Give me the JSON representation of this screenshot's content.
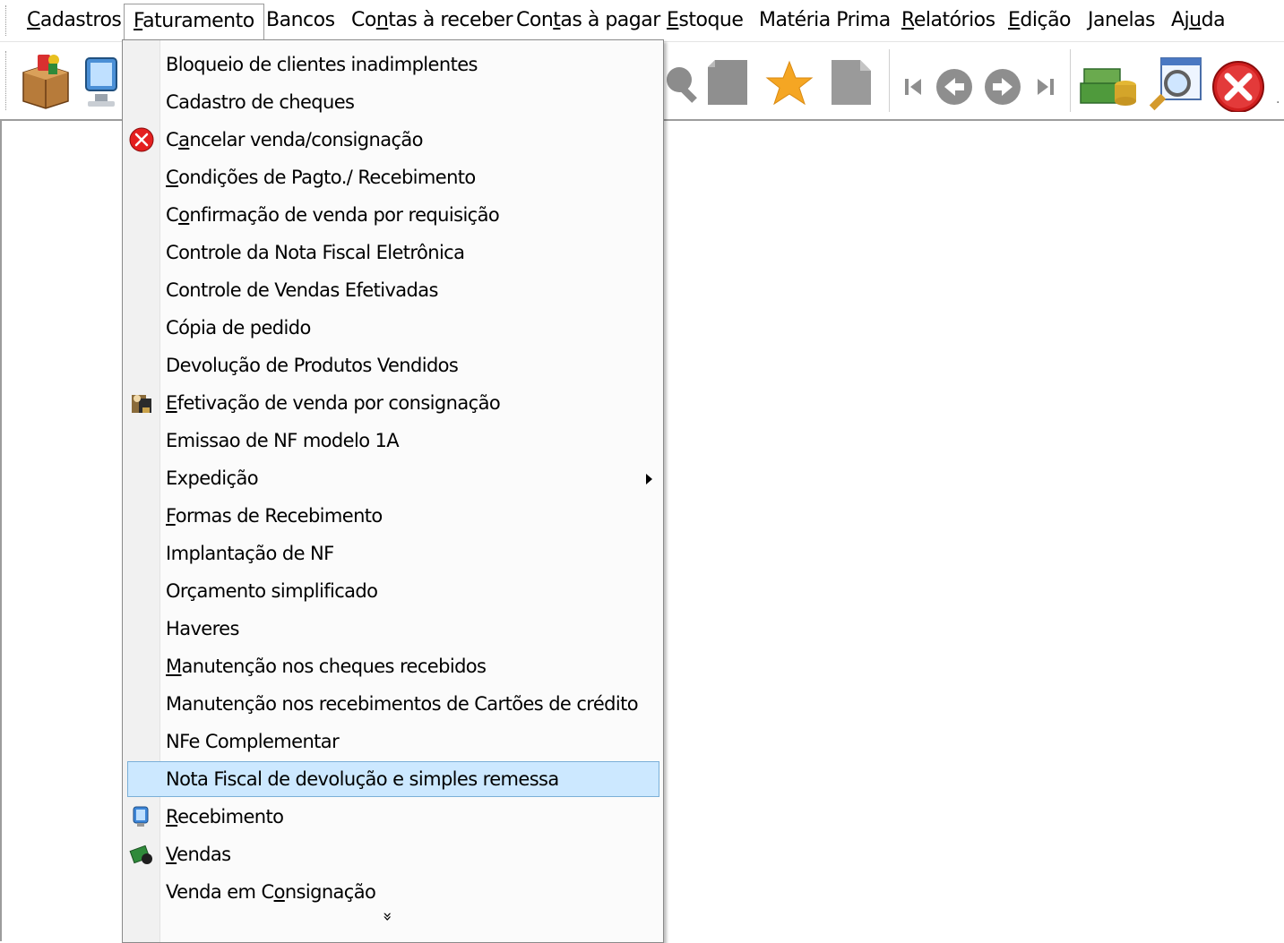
{
  "menubar": {
    "items": [
      {
        "pre": "",
        "u": "C",
        "post": "adastros"
      },
      {
        "pre": "",
        "u": "F",
        "post": "aturamento"
      },
      {
        "pre": "Bancos",
        "u": "",
        "post": ""
      },
      {
        "pre": "Co",
        "u": "n",
        "post": "tas à receber"
      },
      {
        "pre": "Con",
        "u": "t",
        "post": "as à pagar"
      },
      {
        "pre": "",
        "u": "E",
        "post": "stoque"
      },
      {
        "pre": "Matéria Prima",
        "u": "",
        "post": ""
      },
      {
        "pre": "",
        "u": "R",
        "post": "elatórios"
      },
      {
        "pre": "",
        "u": "E",
        "post": "dição"
      },
      {
        "pre": "",
        "u": "J",
        "post": "anelas"
      },
      {
        "pre": "Aj",
        "u": "u",
        "post": "da"
      }
    ]
  },
  "toolbar": {
    "icons": [
      "box-icon",
      "monitor-icon",
      "search-doc-icon",
      "page-icon",
      "star-icon",
      "blank-page-icon",
      "first-icon",
      "prev-icon",
      "next-icon",
      "last-icon",
      "money-icon",
      "magnifier-window-icon",
      "close-icon"
    ]
  },
  "dropdown": {
    "items": [
      {
        "pre": "Bloqueio de clientes inadimplentes",
        "u": "",
        "post": "",
        "icon": ""
      },
      {
        "pre": "Cadastro de cheques",
        "u": "",
        "post": "",
        "icon": ""
      },
      {
        "pre": "C",
        "u": "a",
        "post": "ncelar venda/consignação",
        "icon": "cancel-icon"
      },
      {
        "pre": "",
        "u": "C",
        "post": "ondições de Pagto./ Recebimento",
        "icon": ""
      },
      {
        "pre": "C",
        "u": "o",
        "post": "nfirmação de venda por requisição",
        "icon": ""
      },
      {
        "pre": "Controle da Nota Fiscal Eletrônica",
        "u": "",
        "post": "",
        "icon": ""
      },
      {
        "pre": "Controle de Vendas Efetivadas",
        "u": "",
        "post": "",
        "icon": ""
      },
      {
        "pre": "Cópia de pedido",
        "u": "",
        "post": "",
        "icon": ""
      },
      {
        "pre": "Devolução de Produtos Vendidos",
        "u": "",
        "post": "",
        "icon": ""
      },
      {
        "pre": "",
        "u": "E",
        "post": "fetivação de venda por consignação",
        "icon": "consignment-icon"
      },
      {
        "pre": "Emissao de NF modelo 1A",
        "u": "",
        "post": "",
        "icon": ""
      },
      {
        "pre": "Expedição",
        "u": "",
        "post": "",
        "icon": "",
        "submenu": true
      },
      {
        "pre": "",
        "u": "F",
        "post": "ormas de Recebimento",
        "icon": ""
      },
      {
        "pre": "Implantação de NF",
        "u": "",
        "post": "",
        "icon": ""
      },
      {
        "pre": "Orçamento simplificado",
        "u": "",
        "post": "",
        "icon": ""
      },
      {
        "pre": "Haveres",
        "u": "",
        "post": "",
        "icon": ""
      },
      {
        "pre": "",
        "u": "M",
        "post": "anutenção nos cheques recebidos",
        "icon": ""
      },
      {
        "pre": "Manutenção nos recebimentos de Cartões de crédito",
        "u": "",
        "post": "",
        "icon": ""
      },
      {
        "pre": "NFe Complementar",
        "u": "",
        "post": "",
        "icon": ""
      },
      {
        "pre": "Nota Fiscal de devolução e simples remessa",
        "u": "",
        "post": "",
        "icon": "",
        "highlight": true
      },
      {
        "pre": "",
        "u": "R",
        "post": "ecebimento",
        "icon": "receipt-icon"
      },
      {
        "pre": "",
        "u": "V",
        "post": "endas",
        "icon": "sales-icon"
      },
      {
        "pre": "Venda em C",
        "u": "o",
        "post": "nsignação",
        "icon": ""
      }
    ],
    "more_glyph": "»"
  },
  "colors": {
    "highlight_bg": "#cce8ff",
    "highlight_border": "#7aafd8"
  }
}
